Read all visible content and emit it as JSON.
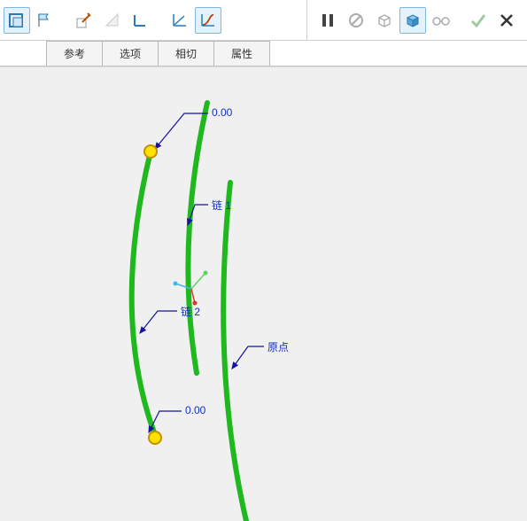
{
  "toolbar": {
    "left": [
      {
        "name": "section-plane-icon",
        "active": true
      },
      {
        "name": "flag-icon",
        "active": false
      },
      {
        "name": "edit-sketch-icon",
        "active": false
      },
      {
        "name": "triangle-plane-icon",
        "active": false
      },
      {
        "name": "angle-icon",
        "active": false
      },
      {
        "name": "graph-linear-icon",
        "active": false
      },
      {
        "name": "graph-curve-icon",
        "active": true
      }
    ],
    "right": [
      {
        "name": "pause-icon",
        "dim": false
      },
      {
        "name": "forbid-icon",
        "dim": true
      },
      {
        "name": "cube-wire-icon",
        "dim": true
      },
      {
        "name": "cube-shaded-icon",
        "dim": false,
        "active": true
      },
      {
        "name": "glasses-icon",
        "dim": true
      },
      {
        "name": "confirm-icon",
        "dim": true
      },
      {
        "name": "cancel-icon",
        "dim": false
      }
    ]
  },
  "tabs": [
    "参考",
    "选项",
    "相切",
    "属性"
  ],
  "labels": {
    "top_value": "0.00",
    "chain1": "链 1",
    "chain2": "链 2",
    "origin": "原点",
    "bottom_value": "0.00"
  },
  "colors": {
    "curve": "#1fb81f",
    "label": "#1430c0",
    "leader": "#14149c",
    "point_outer": "#c09000",
    "point_inner": "#ffe100"
  }
}
